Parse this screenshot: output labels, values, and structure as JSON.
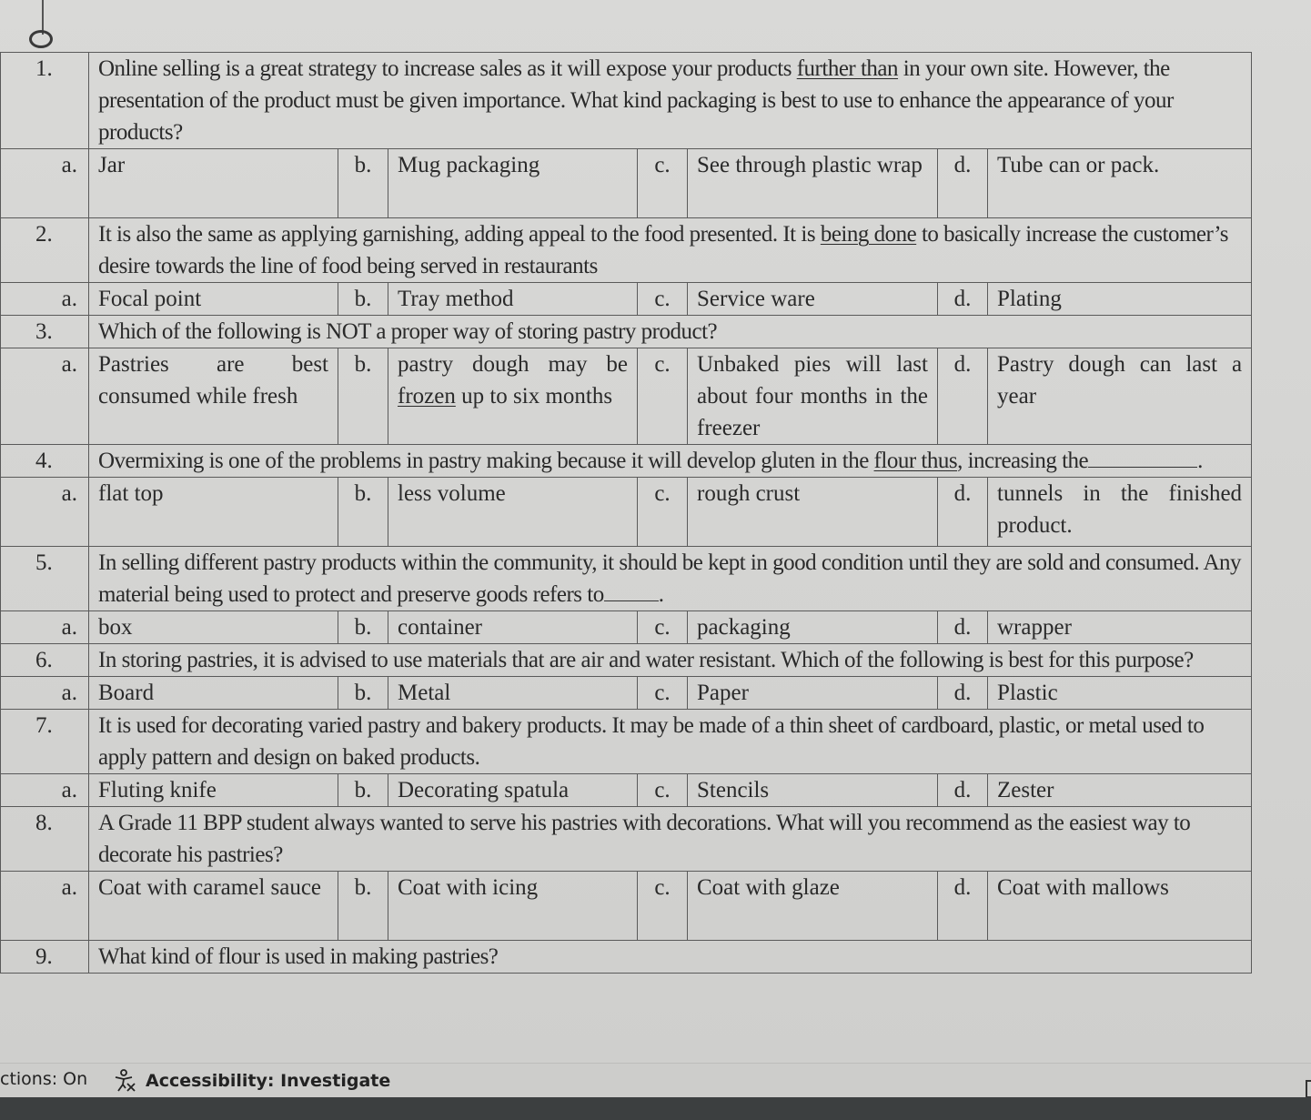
{
  "questions": [
    {
      "number": "1.",
      "text_parts": [
        "Online selling is a great strategy to increase sales as it will expose your products ",
        "further  than",
        " in your own site. However, the presentation of the product must be given importance. What kind packaging is best to use to enhance the appearance of your products?"
      ],
      "choices": [
        {
          "letter": "a.",
          "text": "Jar"
        },
        {
          "letter": "b.",
          "text": "Mug packaging"
        },
        {
          "letter": "c.",
          "text": "See through plastic wrap"
        },
        {
          "letter": "d.",
          "text": "Tube can or pack."
        }
      ]
    },
    {
      "number": "2.",
      "text_parts": [
        "It is also the same as applying garnishing, adding appeal to the food presented. It is ",
        "being  done",
        " to basically increase the customer’s desire towards the line of food being served in  restaurants"
      ],
      "choices": [
        {
          "letter": "a.",
          "text": "Focal point"
        },
        {
          "letter": "b.",
          "text": "Tray method"
        },
        {
          "letter": "c.",
          "text": "Service ware"
        },
        {
          "letter": "d.",
          "text": "Plating"
        }
      ]
    },
    {
      "number": "3.",
      "text_parts": [
        "Which of the following is NOT a proper way of storing pastry product?",
        "",
        ""
      ],
      "choices": [
        {
          "letter": "a.",
          "text": "Pastries are best consumed while fresh"
        },
        {
          "letter": "b.",
          "text_parts": [
            "pastry dough may be ",
            "frozen",
            " up to six months"
          ]
        },
        {
          "letter": "c.",
          "text": "Unbaked pies will last about four months in the freezer"
        },
        {
          "letter": "d.",
          "text": "Pastry dough can last a year"
        }
      ]
    },
    {
      "number": "4.",
      "text_parts": [
        "Overmixing is one of the problems in pastry making because it will develop gluten in the ",
        "flour  thus",
        ", increasing the"
      ],
      "text_suffix": ".",
      "choices": [
        {
          "letter": "a.",
          "text": "flat top"
        },
        {
          "letter": "b.",
          "text": "less volume"
        },
        {
          "letter": "c.",
          "text": "rough crust"
        },
        {
          "letter": "d.",
          "text": "tunnels in the finished product."
        }
      ]
    },
    {
      "number": "5.",
      "text_parts": [
        "In selling different pastry products within the community, it should be kept in good condition until they are sold and consumed. Any material being used to protect and preserve goods refers to",
        "",
        ""
      ],
      "text_suffix": ".",
      "choices": [
        {
          "letter": "a.",
          "text": "box"
        },
        {
          "letter": "b.",
          "text": "container"
        },
        {
          "letter": "c.",
          "text": "packaging"
        },
        {
          "letter": "d.",
          "text": "wrapper"
        }
      ]
    },
    {
      "number": "6.",
      "text_parts": [
        "In storing pastries, it is advised to use materials that are air and water resistant. Which of the   following is best for this purpose?",
        "",
        ""
      ],
      "choices": [
        {
          "letter": "a.",
          "text": "Board"
        },
        {
          "letter": "b.",
          "text": "Metal"
        },
        {
          "letter": "c.",
          "text": "Paper"
        },
        {
          "letter": "d.",
          "text": "Plastic"
        }
      ]
    },
    {
      "number": "7.",
      "text_parts": [
        "It is used for decorating varied pastry and bakery products. It may be made of a thin sheet of   cardboard, plastic, or metal used to apply pattern and design on baked products.",
        "",
        ""
      ],
      "choices": [
        {
          "letter": "a.",
          "text": "Fluting knife"
        },
        {
          "letter": "b.",
          "text": "Decorating spatula"
        },
        {
          "letter": "c.",
          "text": "Stencils"
        },
        {
          "letter": "d.",
          "text": "Zester"
        }
      ]
    },
    {
      "number": "8.",
      "text_parts": [
        "A Grade 11 BPP student always wanted to serve his pastries with decorations. What will you   recommend as the easiest way to decorate his pastries?",
        "",
        ""
      ],
      "choices": [
        {
          "letter": "a.",
          "text": "Coat with caramel sauce"
        },
        {
          "letter": "b.",
          "text": "Coat with icing"
        },
        {
          "letter": "c.",
          "text": "Coat with glaze"
        },
        {
          "letter": "d.",
          "text": "Coat with mallows"
        }
      ]
    },
    {
      "number": "9.",
      "text_parts": [
        "What kind of flour is used in making pastries?",
        "",
        ""
      ],
      "choices": []
    }
  ],
  "status_bar": {
    "predictions": "ctions: On",
    "accessibility_icon": "accessibility-icon",
    "accessibility": "Accessibility: Investigate"
  }
}
